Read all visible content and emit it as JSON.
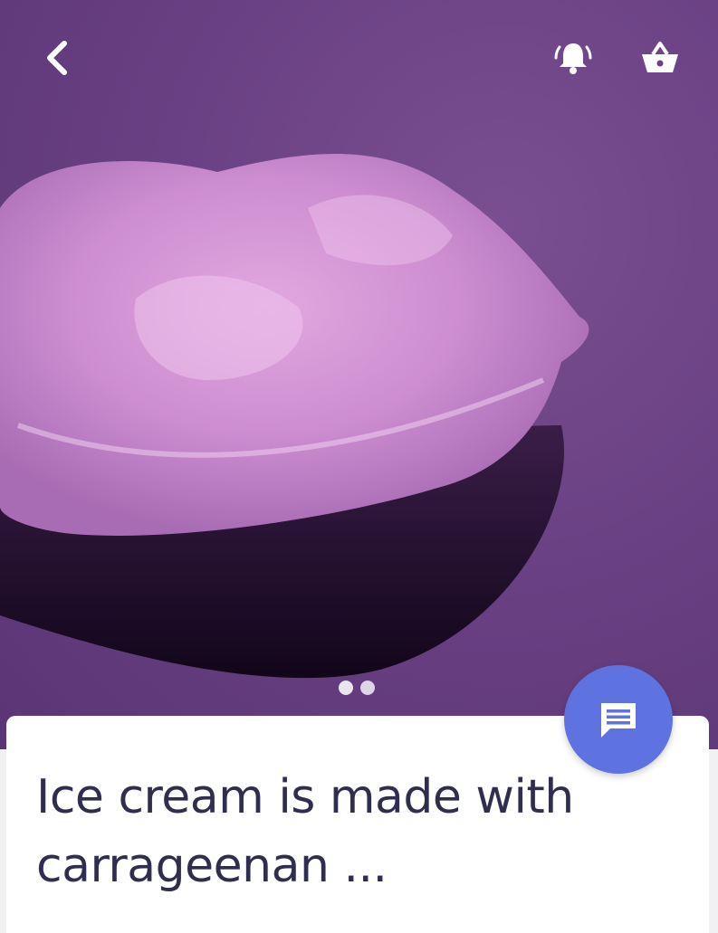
{
  "header": {
    "back_icon": "chevron-left-icon",
    "notification_icon": "bell-ringing-icon",
    "cart_icon": "basket-icon",
    "icon_color": "#ffffff"
  },
  "hero": {
    "background_color": "#6a4184",
    "carousel": {
      "total": 2,
      "active": 1
    }
  },
  "article": {
    "title": "Ice cream is made with carrageenan ..."
  },
  "fab": {
    "icon": "chat-message-icon",
    "color": "#5e72e0"
  }
}
